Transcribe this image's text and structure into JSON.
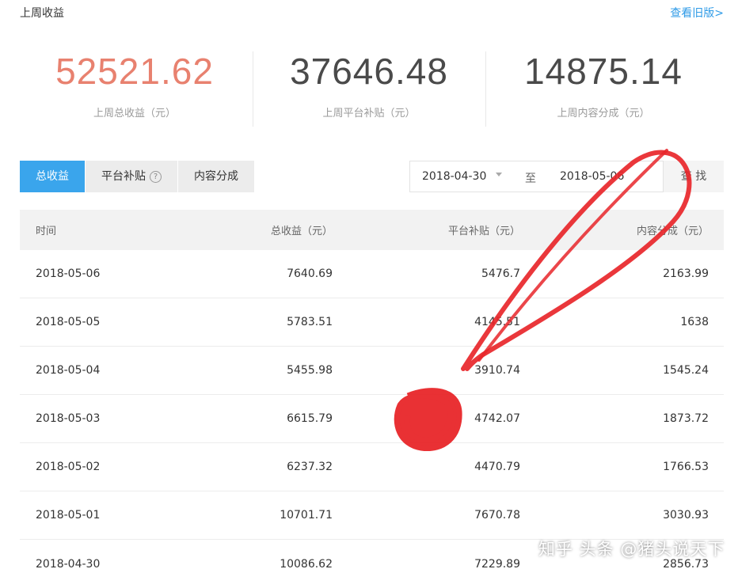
{
  "header": {
    "title": "上周收益",
    "old_version_link": "查看旧版>"
  },
  "stats": [
    {
      "value": "52521.62",
      "label": "上周总收益（元）",
      "color": "#e8816f"
    },
    {
      "value": "37646.48",
      "label": "上周平台补贴（元）",
      "color": "#4a4a4a"
    },
    {
      "value": "14875.14",
      "label": "上周内容分成（元）",
      "color": "#4a4a4a"
    }
  ],
  "tabs": [
    {
      "label": "总收益",
      "active": true
    },
    {
      "label": "平台补贴",
      "has_help_icon": true
    },
    {
      "label": "内容分成"
    }
  ],
  "help_icon_glyph": "?",
  "date_range": {
    "start": "2018-04-30",
    "separator": "至",
    "end": "2018-05-06",
    "query_button": "查 找"
  },
  "table": {
    "columns": [
      "时间",
      "总收益（元）",
      "平台补贴（元）",
      "内容分成（元）"
    ],
    "rows": [
      [
        "2018-05-06",
        "7640.69",
        "5476.7",
        "2163.99"
      ],
      [
        "2018-05-05",
        "5783.51",
        "4145.51",
        "1638"
      ],
      [
        "2018-05-04",
        "5455.98",
        "3910.74",
        "1545.24"
      ],
      [
        "2018-05-03",
        "6615.79",
        "4742.07",
        "1873.72"
      ],
      [
        "2018-05-02",
        "6237.32",
        "4470.79",
        "1766.53"
      ],
      [
        "2018-05-01",
        "10701.71",
        "7670.78",
        "3030.93"
      ],
      [
        "2018-04-30",
        "10086.62",
        "7229.89",
        "2856.73"
      ]
    ]
  },
  "watermark": "知乎 头条 @猪头说天下",
  "colors": {
    "accent": "#3aa5ec",
    "link": "#2f9be7",
    "total_value": "#e8816f",
    "annotation_red": "#e8262a"
  }
}
